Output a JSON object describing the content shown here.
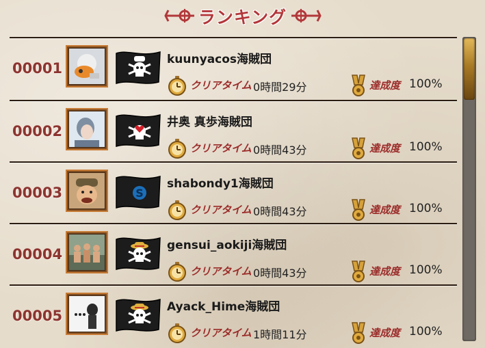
{
  "header": {
    "title": "ランキング"
  },
  "labels": {
    "clear_time": "クリアタイム",
    "achievement": "達成度"
  },
  "colors": {
    "accent_red": "#b2373a",
    "rank_text": "#8d3430",
    "rule": "#2b1d12",
    "scroll_thumb": "#c49540"
  },
  "icons": {
    "header_left": "anchor-icon",
    "header_right": "anchor-icon",
    "clock": "pocket-watch-icon",
    "medal": "medal-icon",
    "flag": "jolly-roger-flag-icon"
  },
  "rows": [
    {
      "rank": "00001",
      "name": "kuunyacos海賊団",
      "clear_time": "0時間29分",
      "achievement": "100%"
    },
    {
      "rank": "00002",
      "name": "井奥 真歩海賊団",
      "clear_time": "0時間43分",
      "achievement": "100%"
    },
    {
      "rank": "00003",
      "name": "shabondy1海賊団",
      "clear_time": "0時間43分",
      "achievement": "100%"
    },
    {
      "rank": "00004",
      "name": "gensui_aokiji海賊団",
      "clear_time": "0時間43分",
      "achievement": "100%"
    },
    {
      "rank": "00005",
      "name": "Ayack_Hime海賊団",
      "clear_time": "1時間11分",
      "achievement": "100%"
    }
  ],
  "scrollbar": {
    "position": 0
  }
}
